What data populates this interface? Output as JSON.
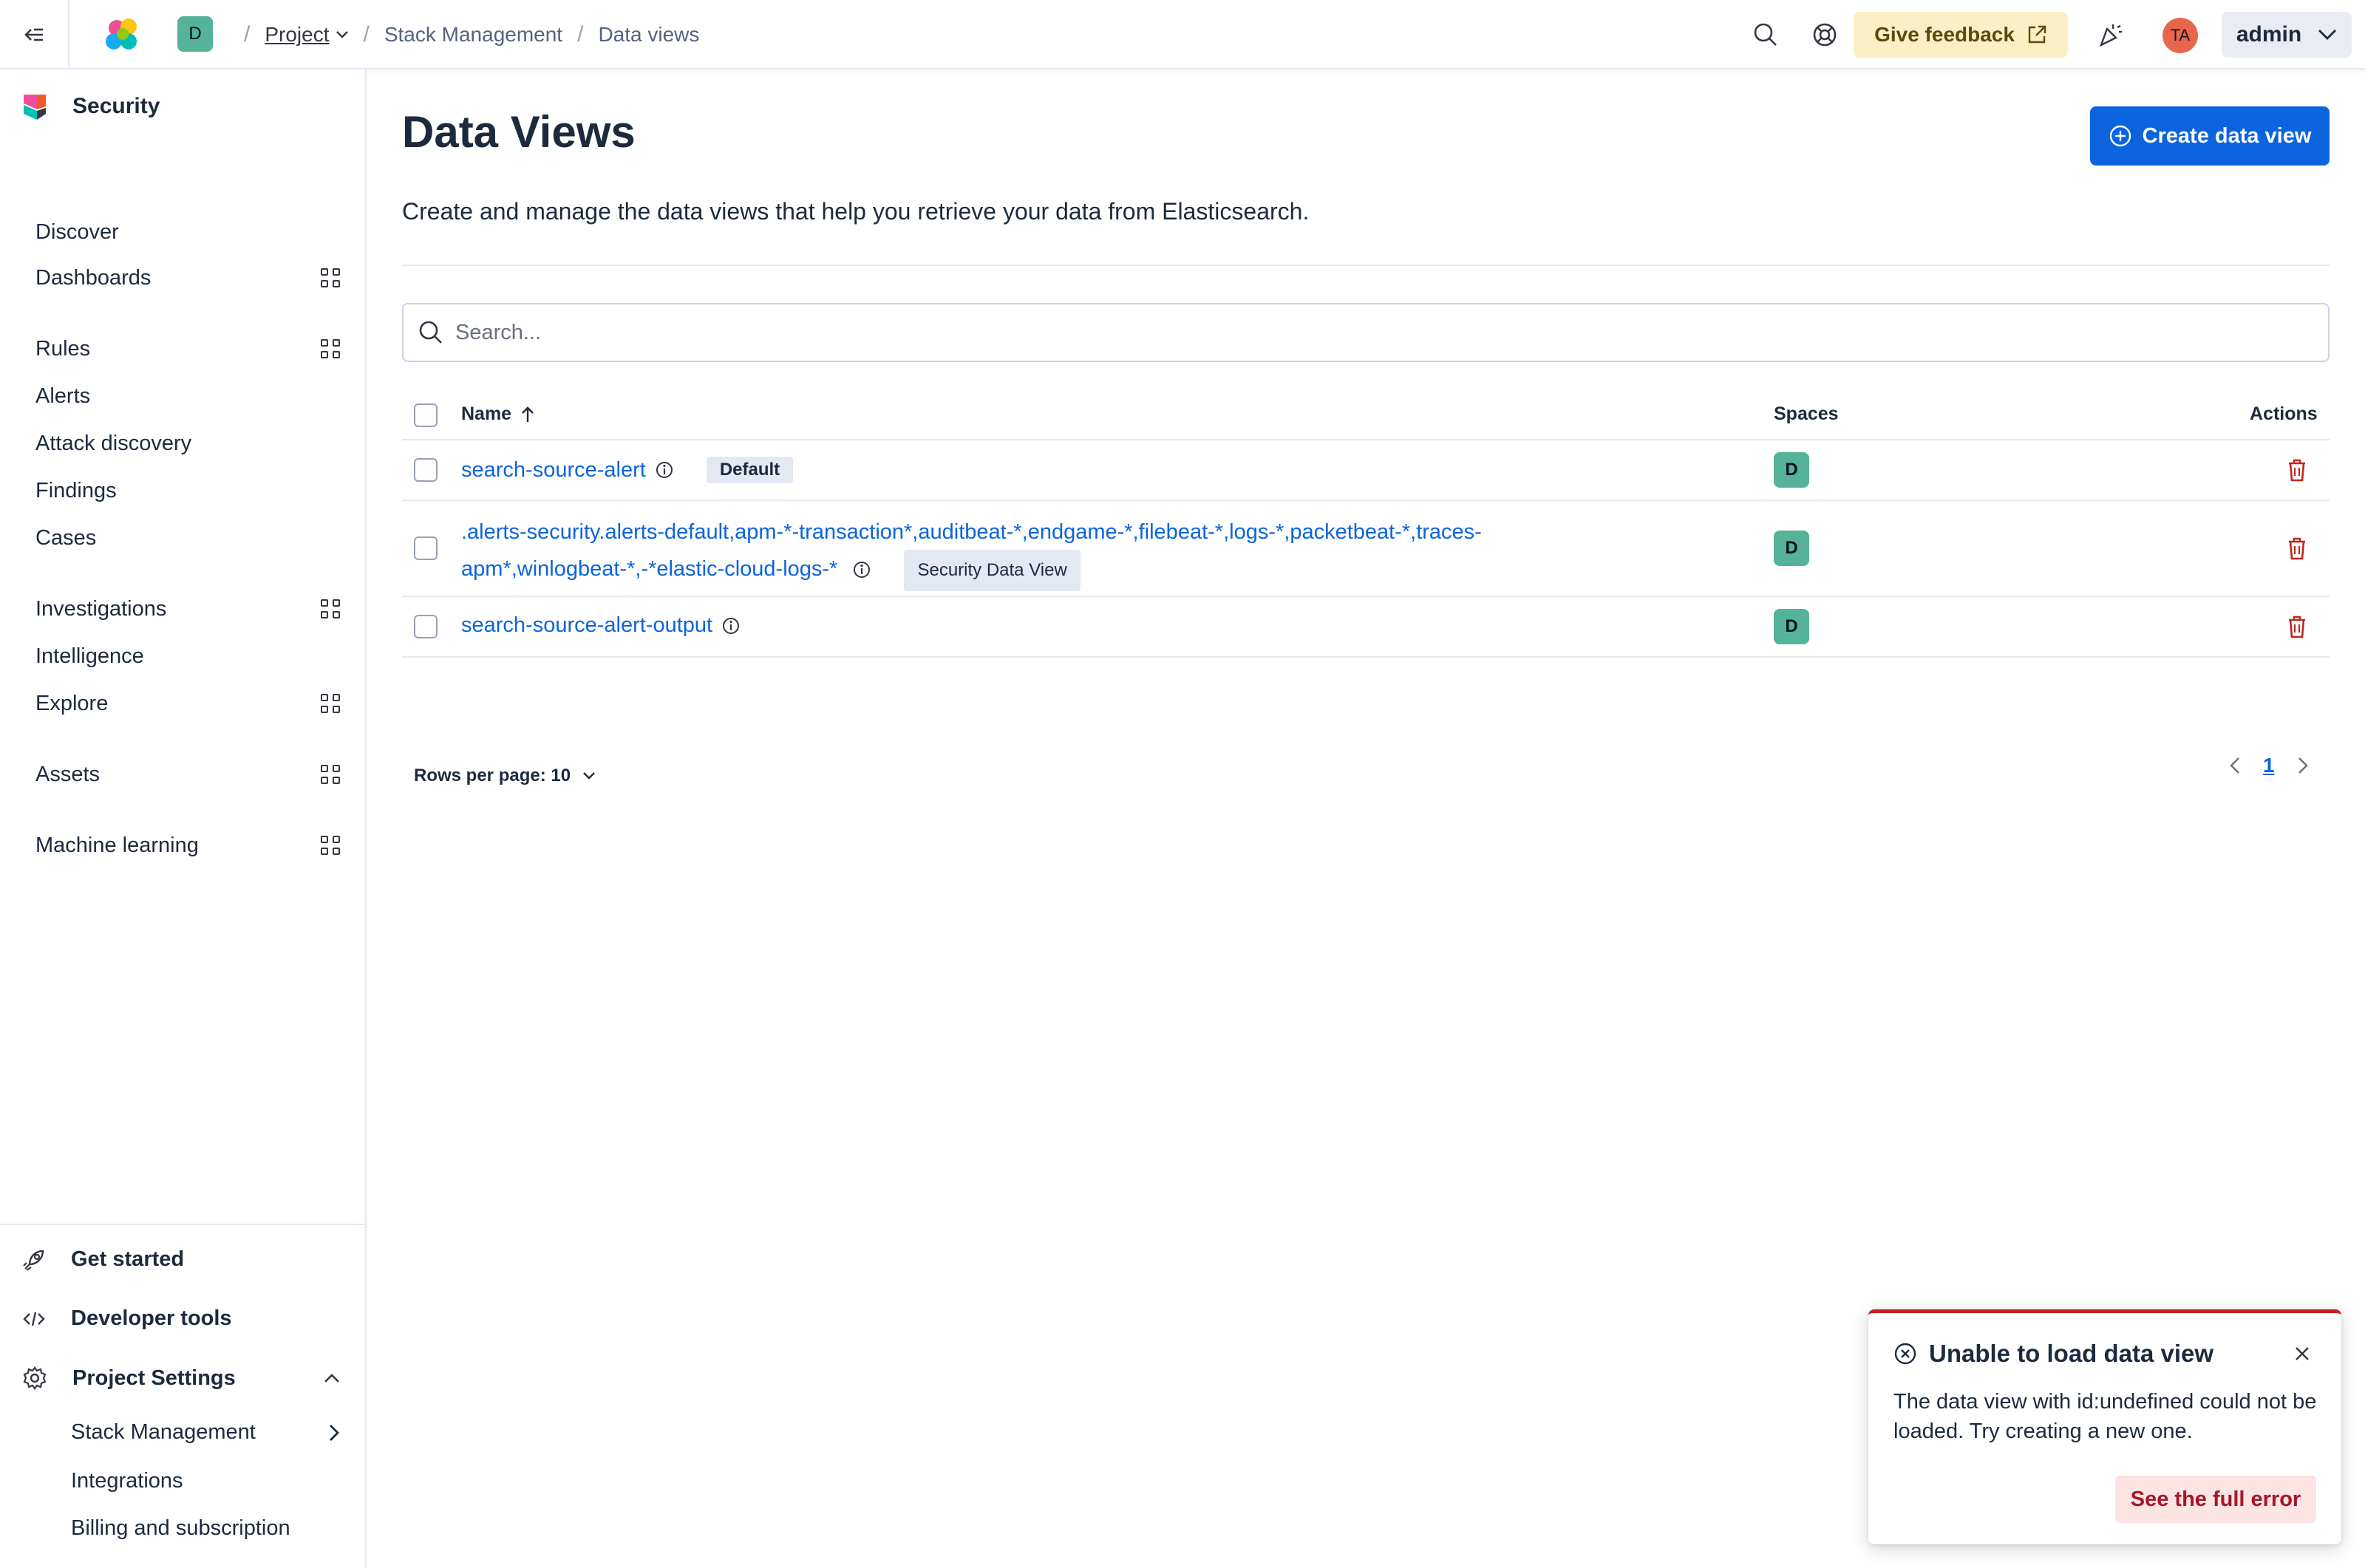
{
  "header": {
    "space_initial": "D",
    "breadcrumbs": [
      "Project",
      "Stack Management",
      "Data views"
    ],
    "feedback_label": "Give feedback",
    "user_initials": "TA",
    "user_menu_label": "admin"
  },
  "sidebar": {
    "title": "Security",
    "items": [
      {
        "label": "Discover"
      },
      {
        "label": "Dashboards"
      },
      {
        "label": "Rules"
      },
      {
        "label": "Alerts"
      },
      {
        "label": "Attack discovery"
      },
      {
        "label": "Findings"
      },
      {
        "label": "Cases"
      },
      {
        "label": "Investigations"
      },
      {
        "label": "Intelligence"
      },
      {
        "label": "Explore"
      },
      {
        "label": "Assets"
      },
      {
        "label": "Machine learning"
      }
    ],
    "footer": {
      "get_started": "Get started",
      "developer_tools": "Developer tools",
      "project_settings": "Project Settings",
      "sub_items": [
        "Stack Management",
        "Integrations",
        "Billing and subscription"
      ]
    }
  },
  "main": {
    "title": "Data Views",
    "create_button": "Create data view",
    "description": "Create and manage the data views that help you retrieve your data from Elasticsearch.",
    "search_placeholder": "Search...",
    "columns": {
      "name": "Name",
      "spaces": "Spaces",
      "actions": "Actions"
    },
    "rows": [
      {
        "name": "search-source-alert",
        "tag": "Default",
        "space": "D"
      },
      {
        "name_line1": ".alerts-security.alerts-default,apm-*-transaction*,auditbeat-*,endgame-*,filebeat-*,logs-*,packetbeat-*,traces-",
        "name_line2": "apm*,winlogbeat-*,-*elastic-cloud-logs-*",
        "tag": "Security Data View",
        "space": "D"
      },
      {
        "name": "search-source-alert-output",
        "space": "D"
      }
    ],
    "rows_per_page": "Rows per page: 10",
    "current_page": "1"
  },
  "toast": {
    "title": "Unable to load data view",
    "body": "The data view with id:undefined could not be loaded. Try creating a new one.",
    "button": "See the full error"
  },
  "colors": {
    "primary": "#0b64dd",
    "danger": "#c61e25",
    "space_badge": "#54b399",
    "feedback_bg": "#fcefc5"
  }
}
